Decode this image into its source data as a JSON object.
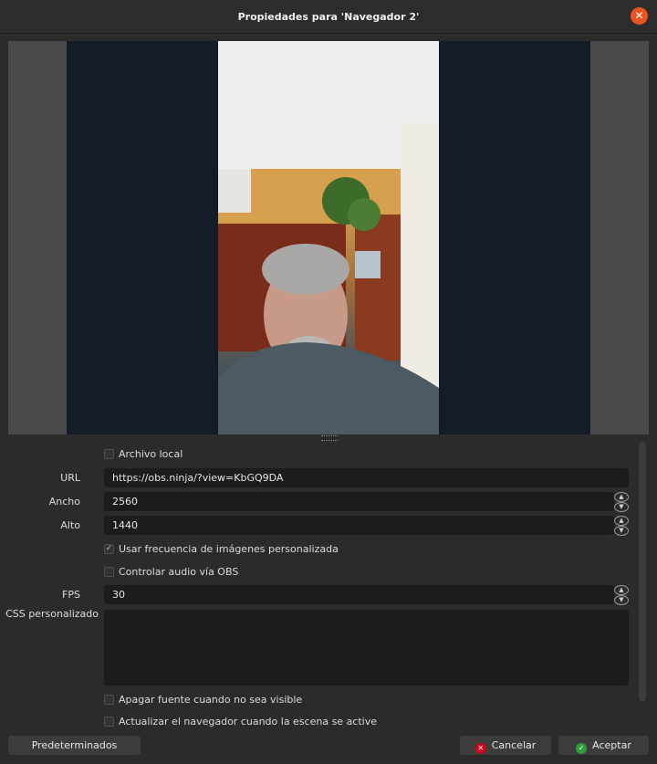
{
  "window": {
    "title": "Propiedades para 'Navegador 2'"
  },
  "form": {
    "local_file_label": "Archivo local",
    "url_label": "URL",
    "url_value": "https://obs.ninja/?view=KbGQ9DA",
    "width_label": "Ancho",
    "width_value": "2560",
    "height_label": "Alto",
    "height_value": "1440",
    "custom_fps_label": "Usar frecuencia de imágenes personalizada",
    "custom_fps_checked": true,
    "audio_label": "Controlar audio vía OBS",
    "fps_label": "FPS",
    "fps_value": "30",
    "css_label": "CSS personalizado",
    "css_value": "",
    "shutdown_label": "Apagar fuente cuando no sea visible",
    "refresh_label": "Actualizar el navegador cuando la escena se active"
  },
  "buttons": {
    "defaults": "Predeterminados",
    "cancel": "Cancelar",
    "accept": "Aceptar"
  },
  "colors": {
    "close_icon": "#e95420",
    "cancel_icon": "#d0021b",
    "accept_icon": "#2e9e3a"
  }
}
